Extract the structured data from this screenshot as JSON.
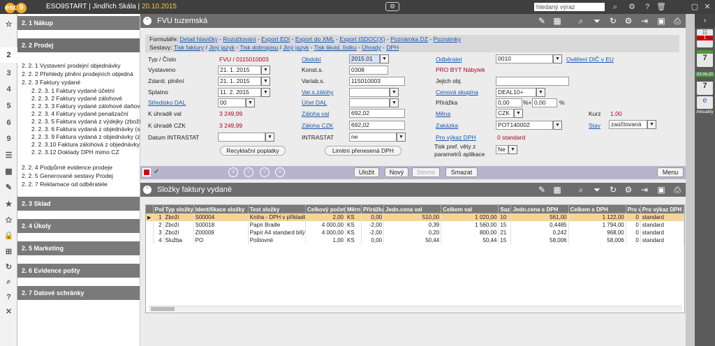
{
  "topbar": {
    "logo": "eso",
    "logo_badge": "9",
    "db": "ESO9START",
    "user": "Jindřich Skála",
    "date": "20.10.2015",
    "search_value": "hledaný výraz"
  },
  "leftbar": [
    "☆",
    "2",
    "3",
    "4",
    "5",
    "6",
    "9"
  ],
  "nav": {
    "sections": [
      "2. 1 Nákup",
      "2. 2 Prodej",
      "2. 3 Sklad",
      "2. 4 Úkoly",
      "2. 5 Marketing",
      "2. 6 Evidence pošty",
      "2. 7 Datové schránky"
    ],
    "items": [
      "2. 2. 1 Vystavení prodejní objednávky",
      "2. 2. 2 Přehledy plnění prodejních objedná",
      "2. 2. 3 Faktury vydané",
      "2. 2. 3. 1 Faktury vydané účetní",
      "2. 2. 3. 2 Faktury vydané zálohové",
      "2. 2. 3. 3 Faktury vydané zálohové daňové",
      "2. 2. 3. 4 Faktury vydané penalizační",
      "2. 2. 3. 5 Faktura vydaná z výdejky (zboží)",
      "2. 2. 3. 6 Faktura vydaná z objednávky (služ",
      "2. 2. 3. 9 Faktura vydaná z objednávky (zbo",
      "2. 2. 3.10 Faktura zálohová z objednávky",
      "2. 2. 3.12 Doklady DPH mimo CZ",
      "2. 2. 4 Podpůrné evidence prodeje",
      "2. 2. 5 Generované sestavy Prodej",
      "2. 2. 7 Reklamace od odběratele"
    ]
  },
  "rightbar": {
    "badge": "1",
    "cal1": "7",
    "date": "03.06.20",
    "cal2": "7",
    "news": "Aktuality"
  },
  "form": {
    "title": "FVU tuzemská",
    "formulare_label": "Formuláře:",
    "formulare": [
      "Detail hlavičky",
      "Rozúčtování",
      "Export EDI",
      "Export do XML",
      "Export ISDOC(X)",
      "Poznámka DZ",
      "Poznámky"
    ],
    "sestavy_label": "Sestavy:",
    "sestavy": [
      "Tisk faktury",
      "Jiný jazyk",
      "Tisk dobropisu",
      "Jiný jazyk",
      "Tisk likvid. lístku",
      "Úhrady",
      "DPH"
    ],
    "typ_label": "Typ / Číslo",
    "typ_value": "FVU / 0115010003",
    "vystaveno_label": "Vystaveno",
    "vystaveno": "21. 1. 2015",
    "zdanit_label": "Zdanit. plnění",
    "zdanit": "21. 1. 2015",
    "splatno_label": "Splatno",
    "splatno": "11. 2. 2015",
    "stredisko_label": "Středisko DAL",
    "stredisko": "00",
    "k_uhrade_val_label": "K úhradě val",
    "k_uhrade_val": "3 249,99",
    "k_uhrade_czk_label": "K úhradě CZK",
    "k_uhrade_czk": "3 249,99",
    "intrastat_date_label": "Datum INTRASTAT",
    "obdobi_label": "Období",
    "obdobi": "2015.01",
    "konst_label": "Konst.s.",
    "konst": "0308",
    "variab_label": "Variab.s.",
    "variab": "115010003",
    "varsz_label": "Var.s.zálohy",
    "ucet_label": "Účet DAL",
    "zaloha_val_label": "Záloha val",
    "zaloha_val": "692,02",
    "zaloha_czk_label": "Záloha CZK",
    "zaloha_czk": "692,02",
    "intrastat_label": "INTRASTAT",
    "intrastat": "ne",
    "odberatel_label": "Odběratel",
    "odberatel": "0010",
    "odberatel_name": "PRO BYT Nábytek",
    "overeni": "Ověření DIČ v EU",
    "jejich_label": "Jejich obj.",
    "cenova_label": "Cenová skupina",
    "cenova": "DEAL10+",
    "prirazka_label": "Přirážka",
    "prirazka1": "0,00",
    "prirazka_sep": "%+",
    "prirazka2": "0,00",
    "prirazka_pct": "%",
    "mena_label": "Měna",
    "mena": "CZK",
    "kurz_label": "Kurz",
    "kurz": "1,00",
    "zakazka_label": "Zakázka",
    "zakazka": "POT140002",
    "stav_label": "Stav",
    "stav": "zaúčtovaná",
    "pro_vykaz_label": "Pro výkaz DPH",
    "pro_vykaz": "0  standard",
    "tisk_label1": "Tisk pref. věty z",
    "tisk_label2": "parametrů aplikace",
    "tisk": "Ne",
    "btn_recykl": "Recyklační poplatky",
    "btn_limit": "Limitní přenesená DPH"
  },
  "actions": {
    "ulozit": "Uložit",
    "novy": "Nový",
    "storno": "Storno",
    "smazat": "Smazat",
    "menu": "Menu"
  },
  "grid_panel": {
    "title": "Složky faktury vydané"
  },
  "grid": {
    "headers": [
      "Poř",
      "Typ složky",
      "Identifikace složky",
      "Text složky",
      "Celkový počet",
      "Měrn",
      "Přirážka",
      "Jedn.cena val",
      "Celkem val",
      "Saz",
      "Jedn.cena s DPH",
      "Celkem s DPH",
      "Pro v",
      "Pro výkaz DPH -"
    ],
    "rows": [
      [
        "1",
        "Zboží",
        "S00004",
        "Kniha - DPH v příkladě",
        "2,00",
        "KS",
        "0,00",
        "510,00",
        "1 020,00",
        "10",
        "561,00",
        "1 122,00",
        "0",
        "standard"
      ],
      [
        "2",
        "Zboží",
        "S00018",
        "Papír Braille",
        "4 000,00",
        "KS",
        "-2,00",
        "0,39",
        "1 560,00",
        "15",
        "0,4485",
        "1 794,00",
        "0",
        "standard"
      ],
      [
        "3",
        "Zboží",
        "Z00009",
        "Papír A4 standard bílý",
        "4 000,00",
        "KS",
        "-2,00",
        "0,20",
        "800,00",
        "21",
        "0,242",
        "968,00",
        "0",
        "standard"
      ],
      [
        "4",
        "Služba",
        "PO",
        "Poštovné",
        "1,00",
        "KS",
        "0,00",
        "50,44",
        "50,44",
        "15",
        "58,006",
        "58,006",
        "0",
        "standard"
      ]
    ]
  }
}
